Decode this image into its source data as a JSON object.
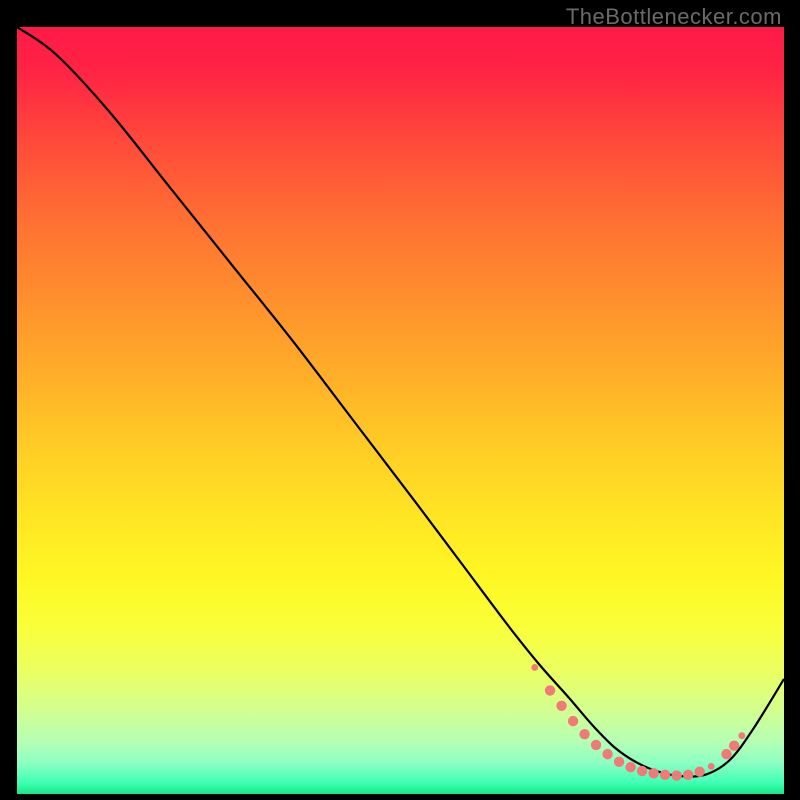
{
  "watermark": "TheBottlenecker.com",
  "chart_data": {
    "type": "line",
    "title": "",
    "xlabel": "",
    "ylabel": "",
    "xlim": [
      0,
      100
    ],
    "ylim": [
      0,
      100
    ],
    "grid": false,
    "background_gradient": [
      {
        "stop": 0.0,
        "color": "#ff1a46"
      },
      {
        "stop": 0.06,
        "color": "#ff2444"
      },
      {
        "stop": 0.15,
        "color": "#ff4a3a"
      },
      {
        "stop": 0.25,
        "color": "#ff6f33"
      },
      {
        "stop": 0.35,
        "color": "#ff8e2d"
      },
      {
        "stop": 0.45,
        "color": "#ffad29"
      },
      {
        "stop": 0.55,
        "color": "#ffcd25"
      },
      {
        "stop": 0.65,
        "color": "#ffe823"
      },
      {
        "stop": 0.72,
        "color": "#fff724"
      },
      {
        "stop": 0.78,
        "color": "#faff38"
      },
      {
        "stop": 0.84,
        "color": "#eaff61"
      },
      {
        "stop": 0.89,
        "color": "#d3ff8f"
      },
      {
        "stop": 0.93,
        "color": "#b6ffb2"
      },
      {
        "stop": 0.96,
        "color": "#8cffc3"
      },
      {
        "stop": 0.985,
        "color": "#3fffb4"
      },
      {
        "stop": 1.0,
        "color": "#17e887"
      }
    ],
    "series": [
      {
        "name": "curve",
        "color": "#000000",
        "x": [
          0,
          5,
          12,
          20,
          28,
          36,
          44,
          52,
          58,
          64,
          68,
          72,
          75,
          78,
          81,
          84,
          87,
          90,
          93,
          96,
          100
        ],
        "y": [
          100,
          96.5,
          89,
          79,
          69,
          59,
          48.5,
          38,
          30,
          22,
          17,
          12.5,
          9,
          6,
          4,
          2.8,
          2.3,
          2.6,
          4.5,
          8.5,
          15
        ]
      }
    ],
    "markers": {
      "name": "dots",
      "color": "#ef7a78",
      "radius_small": 3.4,
      "radius_large": 5.2,
      "points": [
        {
          "x": 67.5,
          "y": 16.5,
          "r": "small"
        },
        {
          "x": 69.5,
          "y": 13.5,
          "r": "large"
        },
        {
          "x": 71.0,
          "y": 11.5,
          "r": "large"
        },
        {
          "x": 72.5,
          "y": 9.5,
          "r": "large"
        },
        {
          "x": 74.0,
          "y": 7.8,
          "r": "large"
        },
        {
          "x": 75.5,
          "y": 6.4,
          "r": "large"
        },
        {
          "x": 77.0,
          "y": 5.2,
          "r": "large"
        },
        {
          "x": 78.5,
          "y": 4.2,
          "r": "large"
        },
        {
          "x": 80.0,
          "y": 3.5,
          "r": "large"
        },
        {
          "x": 81.5,
          "y": 3.0,
          "r": "large"
        },
        {
          "x": 83.0,
          "y": 2.7,
          "r": "large"
        },
        {
          "x": 84.5,
          "y": 2.5,
          "r": "large"
        },
        {
          "x": 86.0,
          "y": 2.4,
          "r": "large"
        },
        {
          "x": 87.5,
          "y": 2.5,
          "r": "large"
        },
        {
          "x": 89.0,
          "y": 2.9,
          "r": "large"
        },
        {
          "x": 90.5,
          "y": 3.6,
          "r": "small"
        },
        {
          "x": 92.5,
          "y": 5.2,
          "r": "large"
        },
        {
          "x": 93.5,
          "y": 6.3,
          "r": "large"
        },
        {
          "x": 94.5,
          "y": 7.6,
          "r": "small"
        }
      ]
    }
  }
}
